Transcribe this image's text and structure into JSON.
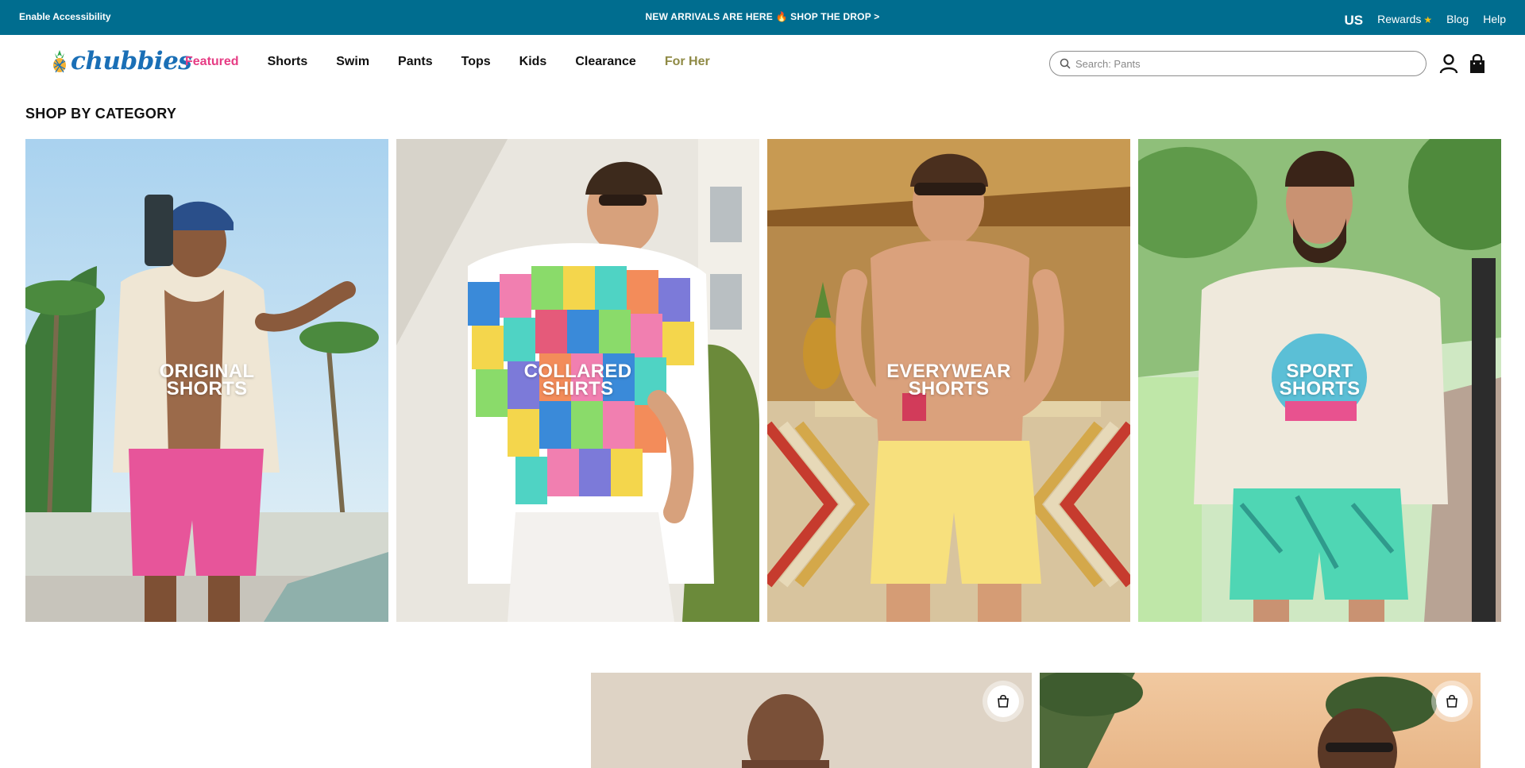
{
  "announcement": {
    "accessibility": "Enable Accessibility",
    "promo": "NEW ARRIVALS ARE HERE 🔥 SHOP THE DROP >",
    "region": "US",
    "rewards": "Rewards",
    "blog": "Blog",
    "help": "Help"
  },
  "header": {
    "logo": "chubbies",
    "nav": [
      "Featured",
      "Shorts",
      "Swim",
      "Pants",
      "Tops",
      "Kids",
      "Clearance",
      "For Her"
    ],
    "search_placeholder": "Search: Pants"
  },
  "category": {
    "title": "SHOP BY CATEGORY",
    "tiles": [
      {
        "line1": "ORIGINAL",
        "line2": "SHORTS"
      },
      {
        "line1": "COLLARED",
        "line2": "SHIRTS"
      },
      {
        "line1": "EVERYWEAR",
        "line2": "SHORTS"
      },
      {
        "line1": "SPORT",
        "line2": "SHORTS"
      }
    ]
  },
  "colors": {
    "topbar": "#006d8f",
    "featured": "#e63c84",
    "forher": "#8f8a45",
    "logo": "#1a6fb6"
  },
  "icons": [
    "search-icon",
    "account-icon",
    "cart-icon",
    "star-icon",
    "add-to-bag-icon"
  ]
}
